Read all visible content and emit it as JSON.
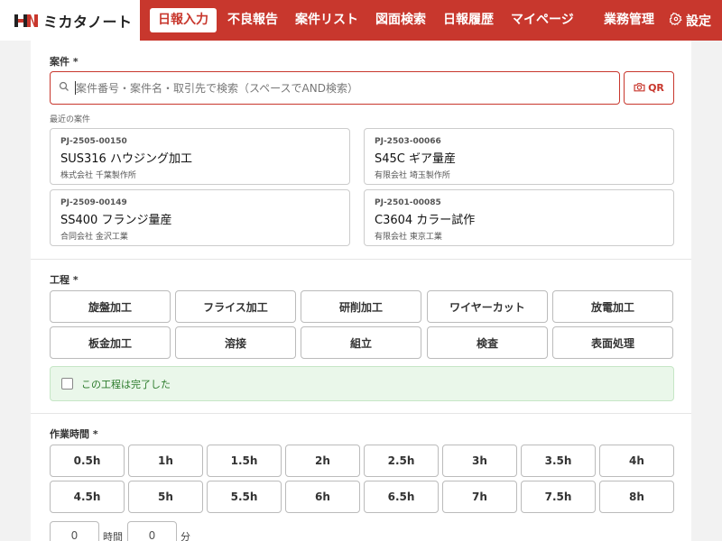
{
  "header": {
    "logo_text": "ミカタノート",
    "nav": [
      {
        "label": "日報入力",
        "active": true
      },
      {
        "label": "不良報告"
      },
      {
        "label": "案件リスト"
      },
      {
        "label": "図面検索"
      },
      {
        "label": "日報履歴"
      },
      {
        "label": "マイページ"
      }
    ],
    "admin_label": "業務管理",
    "settings_label": "設定",
    "brand_color": "#c8372d"
  },
  "project": {
    "label": "案件 *",
    "search_placeholder": "案件番号・案件名・取引先で検索（スペースでAND検索）",
    "qr_label": "QR",
    "recent_label": "最近の案件",
    "recent": [
      {
        "id": "PJ-2505-00150",
        "name": "SUS316 ハウジング加工",
        "company": "株式会社 千葉製作所"
      },
      {
        "id": "PJ-2503-00066",
        "name": "S45C ギア量産",
        "company": "有限会社 埼玉製作所"
      },
      {
        "id": "PJ-2509-00149",
        "name": "SS400 フランジ量産",
        "company": "合同会社 金沢工業"
      },
      {
        "id": "PJ-2501-00085",
        "name": "C3604 カラー試作",
        "company": "有限会社 東京工業"
      }
    ]
  },
  "process": {
    "label": "工程 *",
    "options": [
      "旋盤加工",
      "フライス加工",
      "研削加工",
      "ワイヤーカット",
      "放電加工",
      "板金加工",
      "溶接",
      "組立",
      "検査",
      "表面処理"
    ],
    "complete_label": "この工程は完了した"
  },
  "work_time": {
    "label": "作業時間 *",
    "options": [
      "0.5h",
      "1h",
      "1.5h",
      "2h",
      "2.5h",
      "3h",
      "3.5h",
      "4h",
      "4.5h",
      "5h",
      "5.5h",
      "6h",
      "6.5h",
      "7h",
      "7.5h",
      "8h"
    ],
    "hours_value": "0",
    "hours_unit": "時間",
    "minutes_value": "0",
    "minutes_unit": "分"
  }
}
